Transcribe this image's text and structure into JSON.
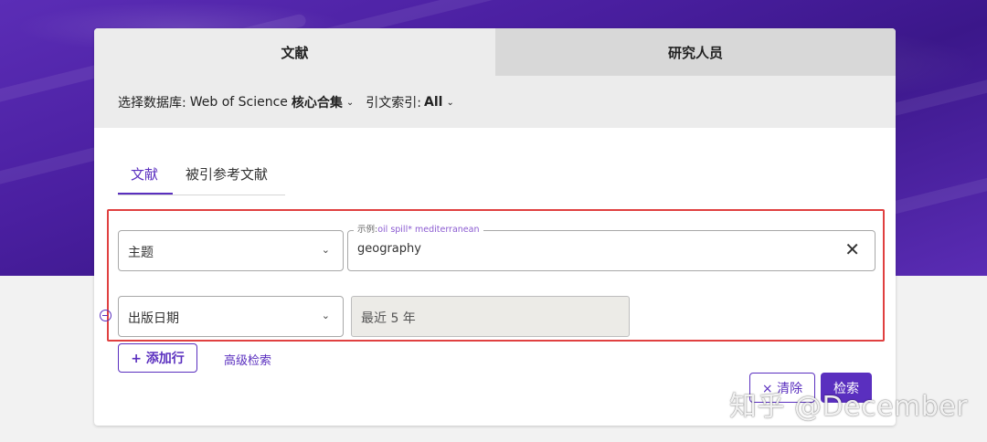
{
  "tabs": {
    "documents": "文献",
    "researchers": "研究人员"
  },
  "database_bar": {
    "select_db_label": "选择数据库:",
    "db_name_prefix": "Web of Science",
    "db_name_bold": "核心合集",
    "citation_index_label": "引文索引:",
    "citation_index_value": "All"
  },
  "sub_tabs": {
    "documents": "文献",
    "cited_references": "被引参考文献"
  },
  "search_row_1": {
    "field": "主题",
    "input_hint_prefix": "示例:",
    "input_hint_example": "oil spill* mediterranean",
    "input_value": "geography",
    "clear_glyph": "✕"
  },
  "search_row_2": {
    "field": "出版日期",
    "value": "最近 5 年"
  },
  "actions": {
    "add_row": "+ 添加行",
    "advanced_search": "高级检索",
    "clear": "× 清除",
    "search": "检索"
  },
  "watermark": "知乎 @December",
  "colors": {
    "accent": "#5a2fbf",
    "highlight_box": "#e04040",
    "background_top": "#4a1fa0"
  }
}
